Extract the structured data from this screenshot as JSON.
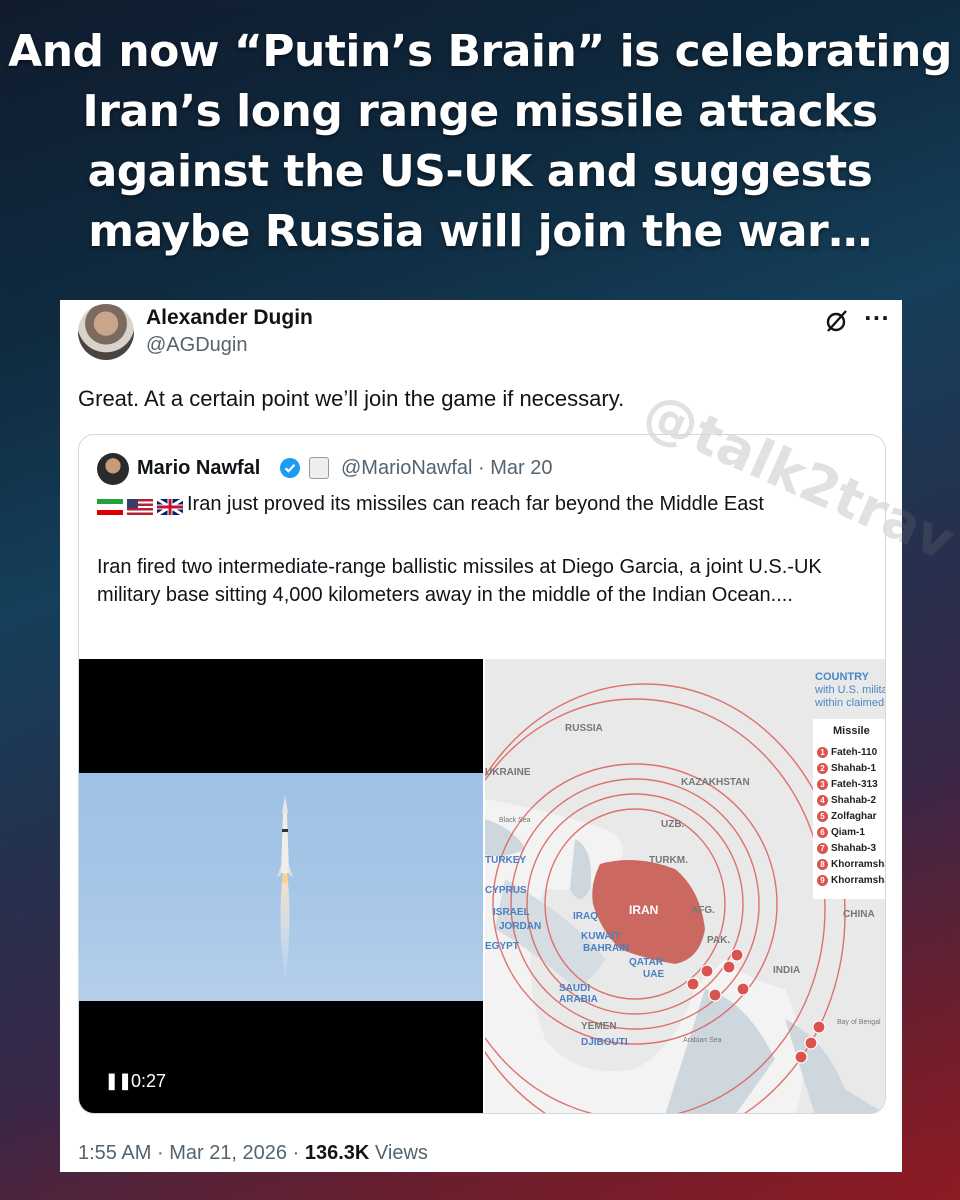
{
  "headline": "And now “Putin’s Brain” is celebrating Iran’s long range missile attacks against the US-UK and suggests maybe Russia will join the war…",
  "watermark": "@talk2trav",
  "tweet": {
    "author_name": "Alexander Dugin",
    "author_handle": "@AGDugin",
    "text": "Great. At a certain point we’ll join the game if necessary.",
    "time": "1:55 AM",
    "date": "Mar 21, 2026",
    "views_count": "136.3K",
    "views_label": "Views"
  },
  "quote": {
    "author_name": "Mario Nawfal",
    "handle_date": "@MarioNawfal · Mar 20",
    "line1": "Iran just proved its missiles can reach far beyond the Middle East",
    "body": "Iran fired two intermediate-range ballistic missiles at Diego Garcia, a joint U.S.-UK military base sitting 4,000 kilometers away in the middle of the Indian Ocean....",
    "video_time": "0:27",
    "pause_glyph": "❚❚"
  },
  "map": {
    "legend_country": "COUNTRY",
    "legend_sub": "with U.S. milita within claimed",
    "legend_title": "Missile",
    "missiles": [
      "Fateh-110",
      "Shahab-1",
      "Fateh-313",
      "Shahab-2",
      "Zolfaghar",
      "Qiam-1",
      "Shahab-3",
      "Khorramsha",
      "Khorramsha"
    ],
    "labels": {
      "russia": "RUSSIA",
      "ukraine": "UKRAINE",
      "kazakhstan": "KAZAKHSTAN",
      "uzb": "UZB.",
      "turkm": "TURKM.",
      "turkey": "TURKEY",
      "cyprus": "CYPRUS",
      "israel": "ISRAEL",
      "jordan": "JORDAN",
      "egypt": "EGYPT",
      "iraq": "IRAQ",
      "kuwait": "KUWAIT",
      "bahrain": "BAHRAIN",
      "qatar": "QATAR",
      "uae": "UAE",
      "iran": "IRAN",
      "afg": "AFG.",
      "pak": "PAK.",
      "india": "INDIA",
      "china": "CHINA",
      "saudi": "SAUDI ARABIA",
      "yemen": "YEMEN",
      "djibouti": "DJIBOUTI",
      "blacksea": "Black Sea",
      "arabian": "Arabian Sea",
      "bengal": "Bay of Bengal"
    }
  }
}
